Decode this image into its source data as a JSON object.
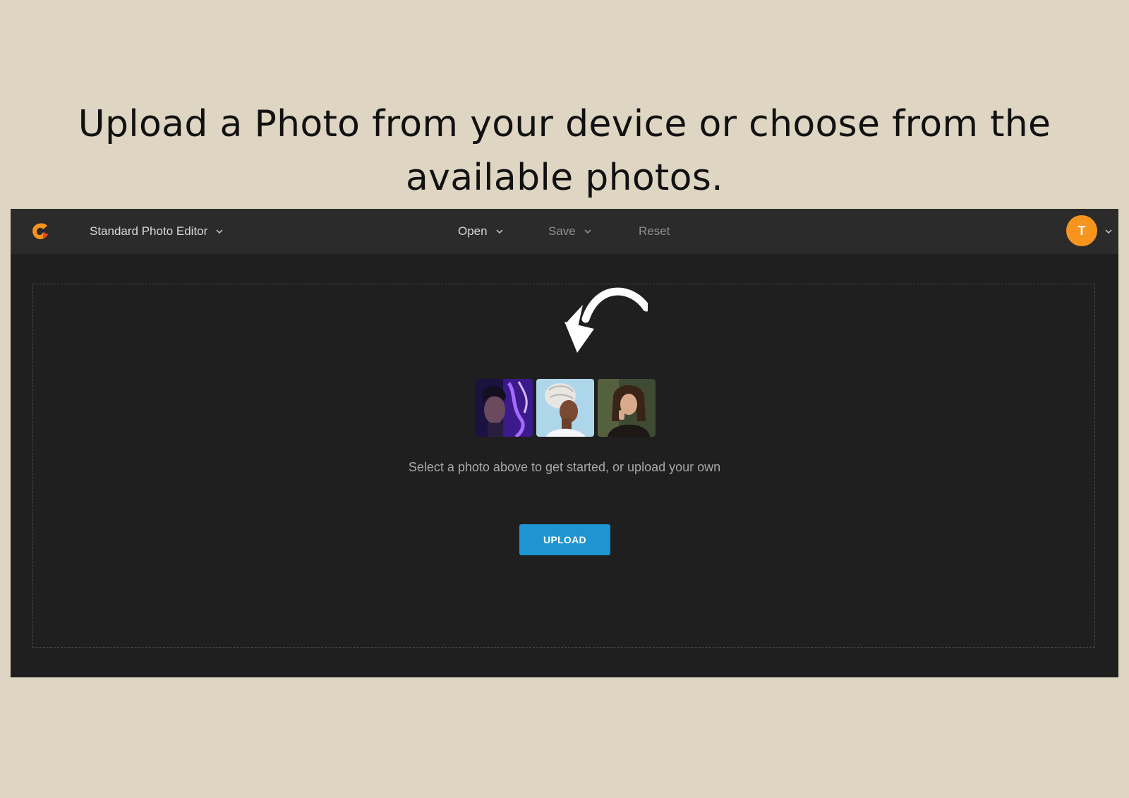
{
  "headline": {
    "line1": "Upload a Photo from your device or choose from the",
    "line2": "available photos."
  },
  "topbar": {
    "logo_icon": "app-logo-icon",
    "editor_label": "Standard Photo Editor",
    "open_label": "Open",
    "save_label": "Save",
    "reset_label": "Reset",
    "avatar_initial": "T"
  },
  "dropzone": {
    "sample_photos": [
      {
        "name": "sample-photo-1"
      },
      {
        "name": "sample-photo-2"
      },
      {
        "name": "sample-photo-3"
      }
    ],
    "hint": "Select a photo above to get started, or upload your own",
    "upload_label": "UPLOAD"
  },
  "colors": {
    "background": "#ded6c2",
    "app_bg": "#1f1f1f",
    "topbar_bg": "#2b2b2b",
    "accent_upload": "#1f94d2",
    "avatar": "#f7941d"
  }
}
